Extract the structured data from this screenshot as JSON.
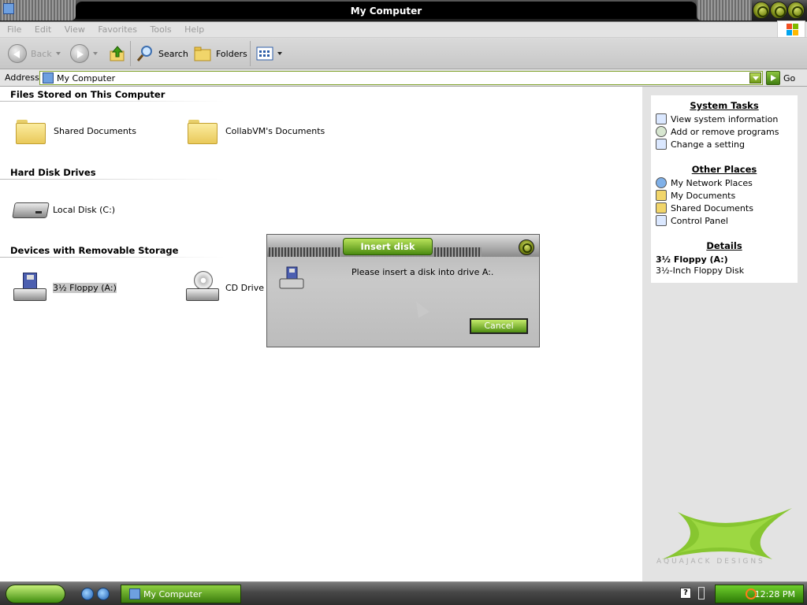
{
  "window": {
    "title": "My Computer"
  },
  "menu": [
    "File",
    "Edit",
    "View",
    "Favorites",
    "Tools",
    "Help"
  ],
  "toolbar": {
    "back_label": "Back",
    "search_label": "Search",
    "folders_label": "Folders"
  },
  "address": {
    "label": "Address",
    "value": "My Computer",
    "go_label": "Go"
  },
  "groups": {
    "files": {
      "title": "Files Stored on This Computer",
      "items": [
        {
          "label": "Shared Documents"
        },
        {
          "label": "CollabVM's Documents"
        }
      ]
    },
    "hdd": {
      "title": "Hard Disk Drives",
      "items": [
        {
          "label": "Local Disk (C:)"
        }
      ]
    },
    "removable": {
      "title": "Devices with Removable Storage",
      "items": [
        {
          "label": "3½ Floppy (A:)",
          "selected": true
        },
        {
          "label": "CD Drive (D"
        }
      ]
    }
  },
  "taskpane": {
    "system_tasks": {
      "title": "System Tasks",
      "links": [
        "View system information",
        "Add or remove programs",
        "Change a setting"
      ]
    },
    "other_places": {
      "title": "Other Places",
      "links": [
        "My Network Places",
        "My Documents",
        "Shared Documents",
        "Control Panel"
      ]
    },
    "details": {
      "title": "Details",
      "name": "3½ Floppy (A:)",
      "type": "3½-Inch Floppy Disk"
    },
    "brand_text": "AQUAJACK DESIGNS"
  },
  "dialog": {
    "title": "Insert disk",
    "message": "Please insert a disk into drive A:.",
    "cancel_label": "Cancel"
  },
  "taskbar": {
    "task_label": "My Computer",
    "help_glyph": "?",
    "time": "12:28 PM"
  },
  "colors": {
    "accent_green": "#4b8b10",
    "chrome_dark": "#1c1c1c",
    "pane_gray": "#e3e3e3"
  }
}
